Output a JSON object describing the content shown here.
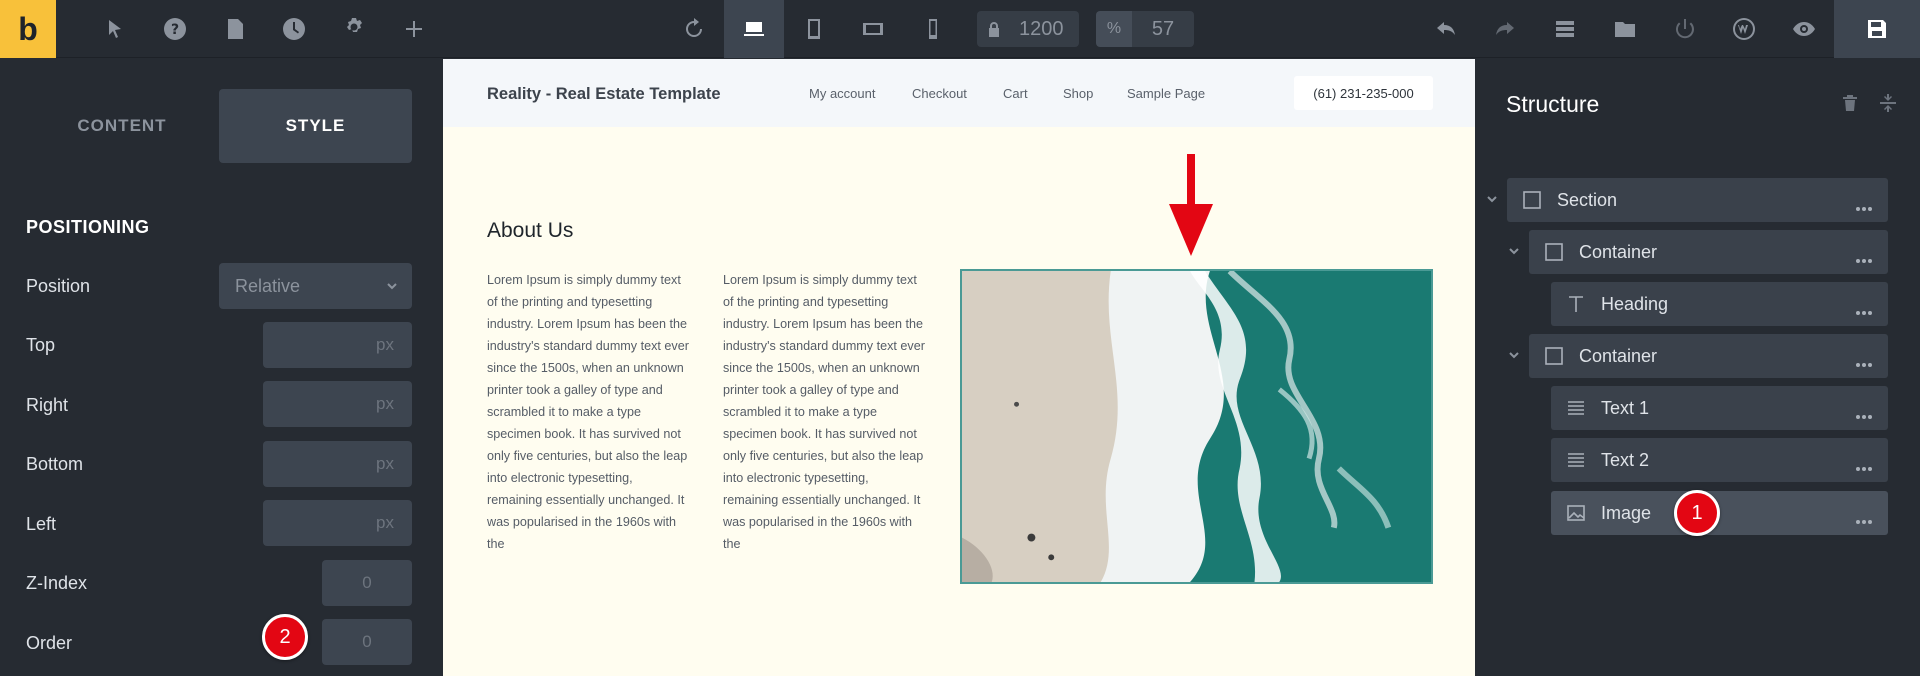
{
  "app": {
    "logo_letter": "b"
  },
  "toolbar": {
    "left_icons": [
      "select-arrow-icon",
      "help-icon",
      "page-icon",
      "history-clock-icon",
      "settings-gear-icon",
      "add-plus-icon"
    ],
    "center_icons": [
      "undo-refresh-icon",
      "laptop-icon",
      "tablet-icon",
      "tablet-landscape-icon",
      "phone-icon"
    ],
    "width_value": "1200",
    "zoom_symbol": "%",
    "zoom_value": "57",
    "right_icons": [
      "undo-icon",
      "redo-icon",
      "layers-icon",
      "folder-icon",
      "power-icon",
      "wordpress-icon",
      "preview-eye-icon",
      "save-icon"
    ]
  },
  "left_panel": {
    "tabs": {
      "content": "CONTENT",
      "style": "STYLE"
    },
    "section_title": "POSITIONING",
    "fields": {
      "position": {
        "label": "Position",
        "value": "Relative"
      },
      "top": {
        "label": "Top",
        "placeholder": "px"
      },
      "right": {
        "label": "Right",
        "placeholder": "px"
      },
      "bottom": {
        "label": "Bottom",
        "placeholder": "px"
      },
      "left": {
        "label": "Left",
        "placeholder": "px"
      },
      "z_index": {
        "label": "Z-Index",
        "placeholder": "0"
      },
      "order": {
        "label": "Order",
        "placeholder": "0"
      }
    }
  },
  "annotations": {
    "badge_1": "1",
    "badge_2": "2"
  },
  "canvas": {
    "site_title": "Reality - Real Estate Template",
    "nav": [
      "My account",
      "Checkout",
      "Cart",
      "Shop",
      "Sample Page"
    ],
    "phone": "(61) 231-235-000",
    "heading": "About Us",
    "text_1": "Lorem Ipsum is simply dummy text of the printing and typesetting industry. Lorem Ipsum has been the industry's standard dummy text ever since the 1500s, when an unknown printer took a galley of type and scrambled it to make a type specimen book. It has survived not only five centuries, but also the leap into electronic typesetting, remaining essentially unchanged. It was popularised in the 1960s with the",
    "text_2": "Lorem Ipsum is simply dummy text of the printing and typesetting industry. Lorem Ipsum has been the industry's standard dummy text ever since the 1500s, when an unknown printer took a galley of type and scrambled it to make a type specimen book. It has survived not only five centuries, but also the leap into electronic typesetting, remaining essentially unchanged. It was popularised in the 1960s with the"
  },
  "structure": {
    "title": "Structure",
    "items": [
      {
        "label": "Section",
        "icon": "square-icon"
      },
      {
        "label": "Container",
        "icon": "square-icon"
      },
      {
        "label": "Heading",
        "icon": "heading-t-icon"
      },
      {
        "label": "Container",
        "icon": "square-icon"
      },
      {
        "label": "Text 1",
        "icon": "text-lines-icon"
      },
      {
        "label": "Text 2",
        "icon": "text-lines-icon"
      },
      {
        "label": "Image",
        "icon": "image-icon"
      }
    ]
  },
  "colors": {
    "accent_logo": "#f8c13a",
    "badge_red": "#e30613",
    "panel_bg": "#262b32",
    "row_bg": "#3a414b"
  }
}
